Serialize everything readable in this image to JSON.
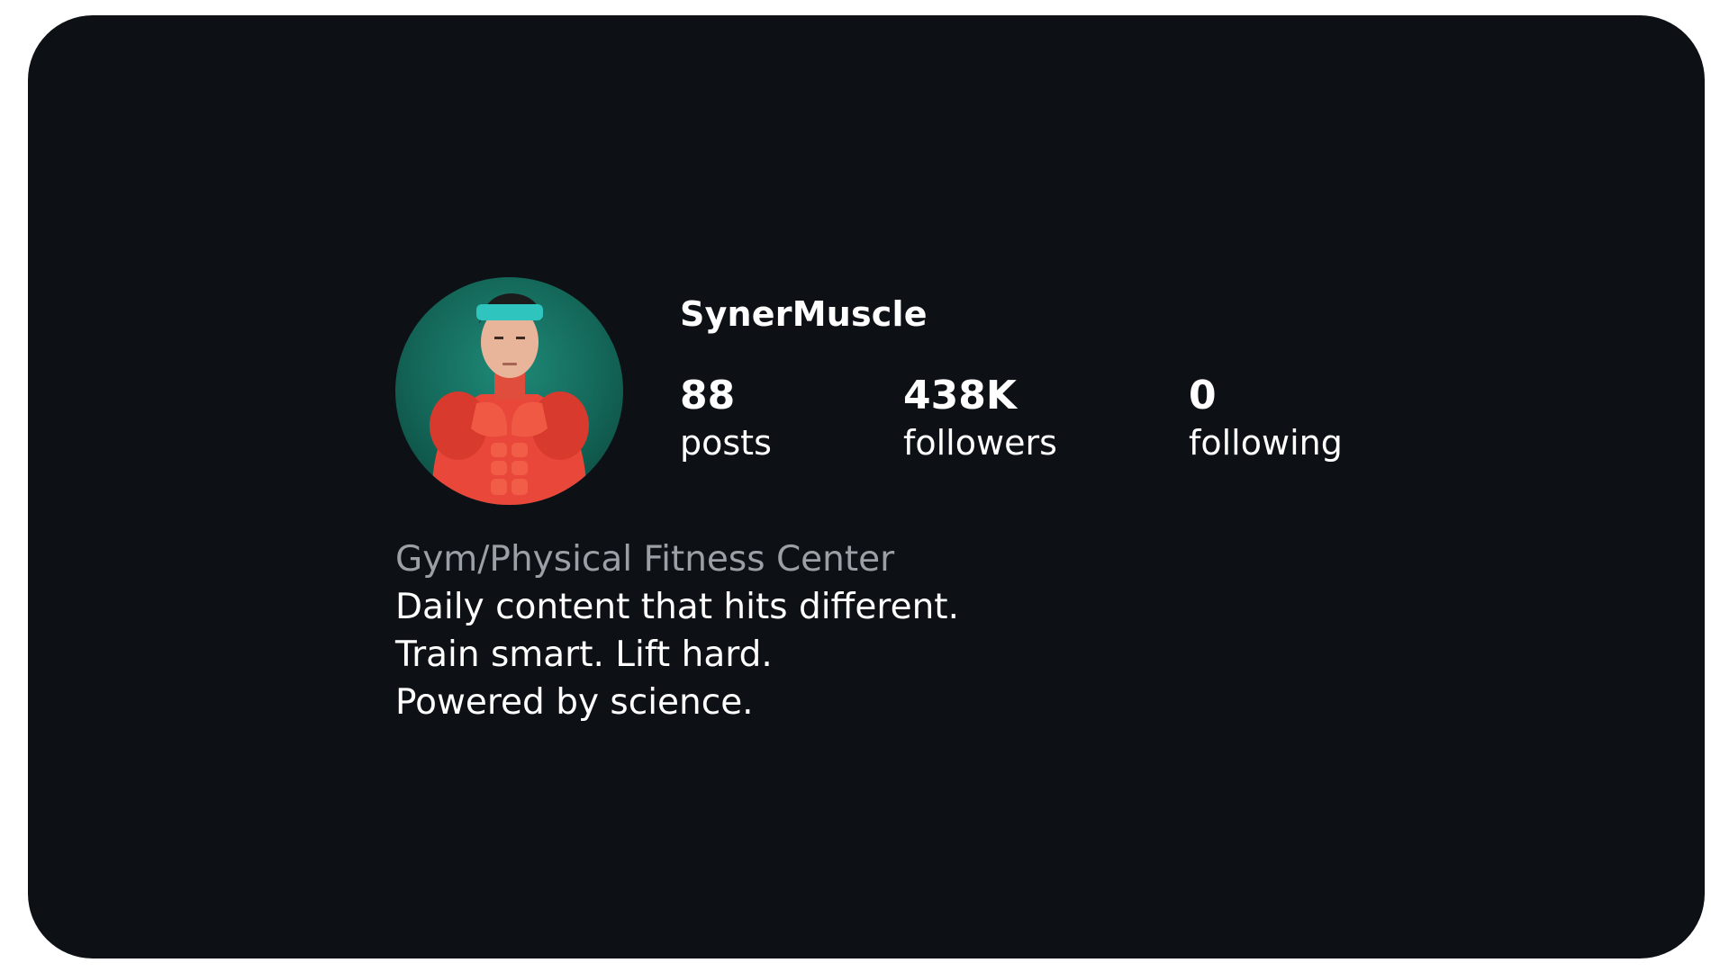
{
  "profile": {
    "username": "SynerMuscle",
    "avatar_icon": "muscle-man-avatar",
    "headband_text": "SynerMuscle",
    "stats": {
      "posts_value": "88",
      "posts_label": "posts",
      "followers_value": "438K",
      "followers_label": "followers",
      "following_value": "0",
      "following_label": "following"
    },
    "category": "Gym/Physical Fitness Center",
    "bio_lines": [
      "Daily content that hits different.",
      "Train smart. Lift hard.",
      "Powered by science."
    ]
  },
  "colors": {
    "background": "#0d1116",
    "text": "#ffffff",
    "category_text": "#9aa0a6",
    "avatar_bg": "#136557",
    "muscle": "#e8473a",
    "headband": "#2fc4bd"
  }
}
